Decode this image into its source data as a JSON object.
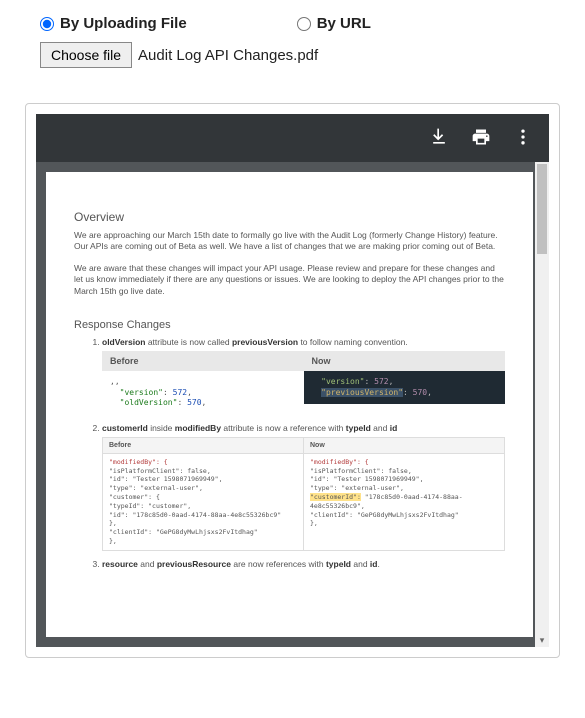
{
  "upload": {
    "byFileLabel": "By Uploading File",
    "byUrlLabel": "By URL",
    "chooseBtn": "Choose file",
    "fileName": "Audit Log API Changes.pdf"
  },
  "doc": {
    "overviewTitle": "Overview",
    "p1": "We are approaching our March 15th date to formally go live with the Audit Log (formerly Change History) feature.  Our APIs are coming out of Beta as well.  We have a list of changes that we are making prior coming out of Beta.",
    "p2": "We are aware that these changes will impact your API usage.  Please review and prepare for these changes and let us know immediately if there are any questions or issues.  We are looking to deploy the API changes prior to the March 15th go live date.",
    "rcTitle": "Response Changes",
    "li1a": "oldVersion",
    "li1b": " attribute is now called ",
    "li1c": "previousVersion",
    "li1d": " to follow naming convention.",
    "before": "Before",
    "now": "Now",
    "c1": {
      "bl1": "\"version\"",
      "bl1n": "572",
      "bl2": "\"oldVersion\"",
      "bl2n": "570",
      "nl1": "\"version\"",
      "nl1n": "572",
      "nl2": "\"previousVersion\"",
      "nl2n": "570"
    },
    "li2a": "customerId",
    "li2b": " inside ",
    "li2c": "modifiedBy",
    "li2d": " attribute is now a reference with ",
    "li2e": "typeId",
    "li2f": " and ",
    "li2g": "id",
    "c2": {
      "b1": "\"modifiedBy\": {",
      "b2": "  \"isPlatformClient\": false,",
      "b3": "  \"id\": \"Tester 1598071969949\",",
      "b4": "  \"type\": \"external-user\",",
      "b5": "  \"customer\": {",
      "b6": "    \"typeId\": \"customer\",",
      "b7": "    \"id\": \"178c85d0-0aad-4174-88aa-4e8c55326bc9\"",
      "b8": "  },",
      "b9": "  \"clientId\": \"GePG8dyMwLhjsxs2FvItdhag\"",
      "b10": "},",
      "n1": "\"modifiedBy\": {",
      "n2": "  \"isPlatformClient\": false,",
      "n3": "  \"id\": \"Tester 1598071969949\",",
      "n4": "  \"type\": \"external-user\",",
      "n5pre": "  ",
      "n5k": "\"customerId\":",
      "n5v": " \"178c85d0-0aad-4174-88aa-4e8c55326bc9\",",
      "n6": "  \"clientId\": \"GePG8dyMwLhjsxs2FvItdhag\"",
      "n7": "},"
    },
    "li3a": "resource",
    "li3b": " and ",
    "li3c": "previousResource",
    "li3d": " are now references with ",
    "li3e": "typeId",
    "li3f": " and ",
    "li3g": "id",
    "li3h": "."
  }
}
